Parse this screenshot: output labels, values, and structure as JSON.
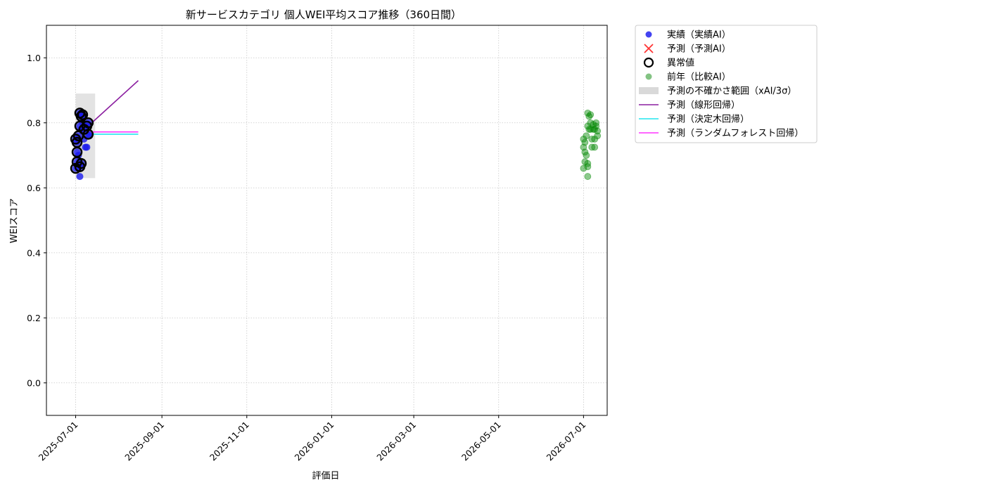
{
  "chart_data": {
    "type": "scatter",
    "title": "新サービスカテゴリ 個人WEI平均スコア推移（360日間）",
    "xlabel": "評価日",
    "ylabel": "WEIスコア",
    "xlim": [
      "2025-06-10",
      "2026-07-18"
    ],
    "ylim": [
      -0.1,
      1.1
    ],
    "yticks": [
      0.0,
      0.2,
      0.4,
      0.6,
      0.8,
      1.0
    ],
    "ytick_labels": [
      "0.0",
      "0.2",
      "0.4",
      "0.6",
      "0.8",
      "1.0"
    ],
    "xticks": [
      "2025-07-01",
      "2025-09-01",
      "2025-11-01",
      "2026-01-01",
      "2026-03-01",
      "2026-05-01",
      "2026-07-01"
    ],
    "grid": true,
    "legend_position": "outside-right",
    "legend": [
      {
        "label": "実績（実績AI）",
        "marker": "dot",
        "color": "#2222ee"
      },
      {
        "label": "予測（予測AI）",
        "marker": "x",
        "color": "#ff3333"
      },
      {
        "label": "異常値",
        "marker": "ring",
        "color": "#000000"
      },
      {
        "label": "前年（比較AI）",
        "marker": "dot",
        "color": "#6db86d"
      },
      {
        "label": "予測の不確かさ範囲（xAI/3σ）",
        "marker": "band",
        "color": "#d9d9d9"
      },
      {
        "label": "予測（線形回帰）",
        "marker": "line",
        "color": "#8b1fa0"
      },
      {
        "label": "予測（決定木回帰）",
        "marker": "line",
        "color": "#22e5ee"
      },
      {
        "label": "予測（ランダムフォレスト回帰）",
        "marker": "line",
        "color": "#ff33ff"
      }
    ],
    "actual": [
      {
        "x": "2025-07-01",
        "y": 0.66
      },
      {
        "x": "2025-07-01",
        "y": 0.75
      },
      {
        "x": "2025-07-02",
        "y": 0.71
      },
      {
        "x": "2025-07-02",
        "y": 0.68
      },
      {
        "x": "2025-07-02",
        "y": 0.74
      },
      {
        "x": "2025-07-03",
        "y": 0.76
      },
      {
        "x": "2025-07-03",
        "y": 0.7
      },
      {
        "x": "2025-07-04",
        "y": 0.665
      },
      {
        "x": "2025-07-04",
        "y": 0.635
      },
      {
        "x": "2025-07-04",
        "y": 0.79
      },
      {
        "x": "2025-07-04",
        "y": 0.83
      },
      {
        "x": "2025-07-05",
        "y": 0.82
      },
      {
        "x": "2025-07-05",
        "y": 0.78
      },
      {
        "x": "2025-07-05",
        "y": 0.675
      },
      {
        "x": "2025-07-06",
        "y": 0.825
      },
      {
        "x": "2025-07-06",
        "y": 0.8
      },
      {
        "x": "2025-07-07",
        "y": 0.78
      },
      {
        "x": "2025-07-07",
        "y": 0.75
      },
      {
        "x": "2025-07-08",
        "y": 0.725
      },
      {
        "x": "2025-07-09",
        "y": 0.725
      },
      {
        "x": "2025-07-09",
        "y": 0.79
      },
      {
        "x": "2025-07-10",
        "y": 0.765
      },
      {
        "x": "2025-07-10",
        "y": 0.8
      },
      {
        "x": "2025-07-11",
        "y": 0.76
      }
    ],
    "anomalies": [
      {
        "x": "2025-07-01",
        "y": 0.66
      },
      {
        "x": "2025-07-01",
        "y": 0.75
      },
      {
        "x": "2025-07-02",
        "y": 0.71
      },
      {
        "x": "2025-07-02",
        "y": 0.68
      },
      {
        "x": "2025-07-02",
        "y": 0.74
      },
      {
        "x": "2025-07-03",
        "y": 0.76
      },
      {
        "x": "2025-07-04",
        "y": 0.665
      },
      {
        "x": "2025-07-04",
        "y": 0.79
      },
      {
        "x": "2025-07-04",
        "y": 0.83
      },
      {
        "x": "2025-07-05",
        "y": 0.82
      },
      {
        "x": "2025-07-05",
        "y": 0.675
      },
      {
        "x": "2025-07-06",
        "y": 0.825
      },
      {
        "x": "2025-07-07",
        "y": 0.78
      },
      {
        "x": "2025-07-09",
        "y": 0.79
      },
      {
        "x": "2025-07-10",
        "y": 0.8
      },
      {
        "x": "2025-07-10",
        "y": 0.765
      }
    ],
    "previous_year": [
      {
        "x": "2026-07-01",
        "y": 0.66
      },
      {
        "x": "2026-07-01",
        "y": 0.725
      },
      {
        "x": "2026-07-01",
        "y": 0.75
      },
      {
        "x": "2026-07-02",
        "y": 0.71
      },
      {
        "x": "2026-07-02",
        "y": 0.68
      },
      {
        "x": "2026-07-02",
        "y": 0.74
      },
      {
        "x": "2026-07-03",
        "y": 0.76
      },
      {
        "x": "2026-07-03",
        "y": 0.7
      },
      {
        "x": "2026-07-04",
        "y": 0.635
      },
      {
        "x": "2026-07-04",
        "y": 0.665
      },
      {
        "x": "2026-07-04",
        "y": 0.79
      },
      {
        "x": "2026-07-04",
        "y": 0.83
      },
      {
        "x": "2026-07-04",
        "y": 0.675
      },
      {
        "x": "2026-07-05",
        "y": 0.82
      },
      {
        "x": "2026-07-05",
        "y": 0.78
      },
      {
        "x": "2026-07-06",
        "y": 0.825
      },
      {
        "x": "2026-07-06",
        "y": 0.8
      },
      {
        "x": "2026-07-06",
        "y": 0.78
      },
      {
        "x": "2026-07-07",
        "y": 0.75
      },
      {
        "x": "2026-07-07",
        "y": 0.725
      },
      {
        "x": "2026-07-08",
        "y": 0.78
      },
      {
        "x": "2026-07-08",
        "y": 0.795
      },
      {
        "x": "2026-07-09",
        "y": 0.725
      },
      {
        "x": "2026-07-09",
        "y": 0.78
      },
      {
        "x": "2026-07-10",
        "y": 0.8
      },
      {
        "x": "2026-07-10",
        "y": 0.79
      },
      {
        "x": "2026-07-11",
        "y": 0.775
      },
      {
        "x": "2026-07-11",
        "y": 0.76
      },
      {
        "x": "2026-07-09",
        "y": 0.75
      }
    ],
    "forecast_band": {
      "x_start": "2025-07-01",
      "x_end": "2025-07-15",
      "y_low": 0.63,
      "y_high": 0.89
    },
    "forecast_lines": [
      {
        "name": "予測（線形回帰）",
        "color": "#8b1fa0",
        "points": [
          {
            "x": "2025-07-10",
            "y": 0.79
          },
          {
            "x": "2025-08-15",
            "y": 0.93
          }
        ]
      },
      {
        "name": "予測（決定木回帰）",
        "color": "#22e5ee",
        "points": [
          {
            "x": "2025-07-10",
            "y": 0.765
          },
          {
            "x": "2025-08-15",
            "y": 0.765
          }
        ]
      },
      {
        "name": "予測（ランダムフォレスト回帰）",
        "color": "#ff33ff",
        "points": [
          {
            "x": "2025-07-10",
            "y": 0.772
          },
          {
            "x": "2025-08-15",
            "y": 0.772
          }
        ]
      }
    ]
  }
}
